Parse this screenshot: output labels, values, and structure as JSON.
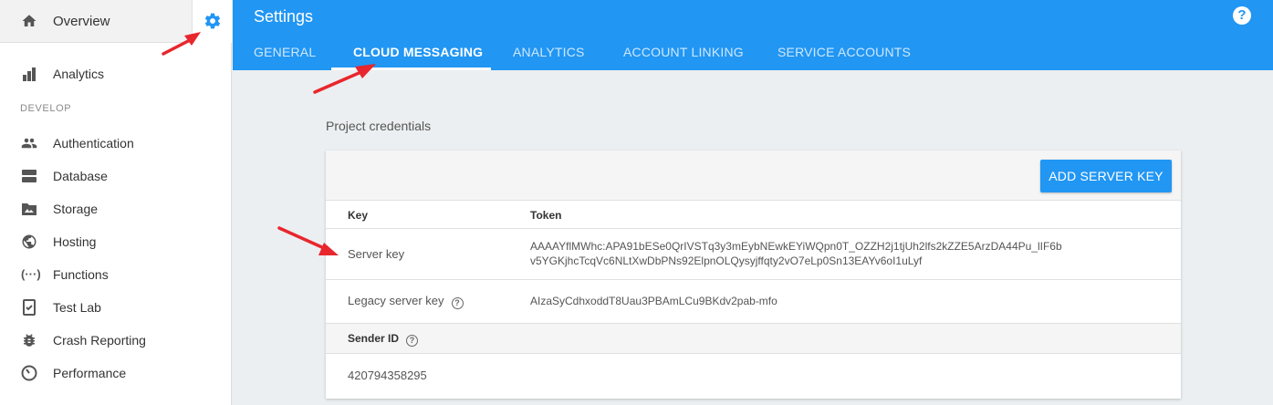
{
  "sidebar": {
    "overview_label": "Overview",
    "analytics_label": "Analytics",
    "develop_label": "DEVELOP",
    "items": [
      {
        "label": "Authentication",
        "icon": "people-icon"
      },
      {
        "label": "Database",
        "icon": "database-icon"
      },
      {
        "label": "Storage",
        "icon": "storage-icon"
      },
      {
        "label": "Hosting",
        "icon": "globe-icon"
      },
      {
        "label": "Functions",
        "icon": "functions-icon"
      },
      {
        "label": "Test Lab",
        "icon": "test-lab-icon"
      },
      {
        "label": "Crash Reporting",
        "icon": "bug-icon"
      },
      {
        "label": "Performance",
        "icon": "speedometer-icon"
      }
    ]
  },
  "header": {
    "title": "Settings",
    "tabs": [
      {
        "label": "GENERAL",
        "active": false
      },
      {
        "label": "CLOUD MESSAGING",
        "active": true
      },
      {
        "label": "ANALYTICS",
        "active": false
      },
      {
        "label": "ACCOUNT LINKING",
        "active": false
      },
      {
        "label": "SERVICE ACCOUNTS",
        "active": false
      }
    ],
    "help_icon": "?"
  },
  "main": {
    "section_title": "Project credentials",
    "add_button_label": "ADD SERVER KEY",
    "table": {
      "col_key": "Key",
      "col_token": "Token",
      "rows": [
        {
          "key": "Server key",
          "token_line1": "AAAAYflMWhc:APA91bESe0QrIVSTq3y3mEybNEwkEYiWQpn0T_OZZH2j1tjUh2lfs2kZZE5ArzDA44Pu_lIF6b",
          "token_line2": "v5YGKjhcTcqVc6NLtXwDbPNs92ElpnOLQysyjffqty2vO7eLp0Sn13EAYv6oI1uLyf"
        },
        {
          "key": "Legacy server key",
          "token": "AIzaSyCdhxoddT8Uau3PBAmLCu9BKdv2pab-mfo"
        }
      ]
    },
    "sender_id_label": "Sender ID",
    "sender_id_value": "420794358295"
  },
  "colors": {
    "brand": "#2196f3",
    "arrow": "#e8262d"
  }
}
